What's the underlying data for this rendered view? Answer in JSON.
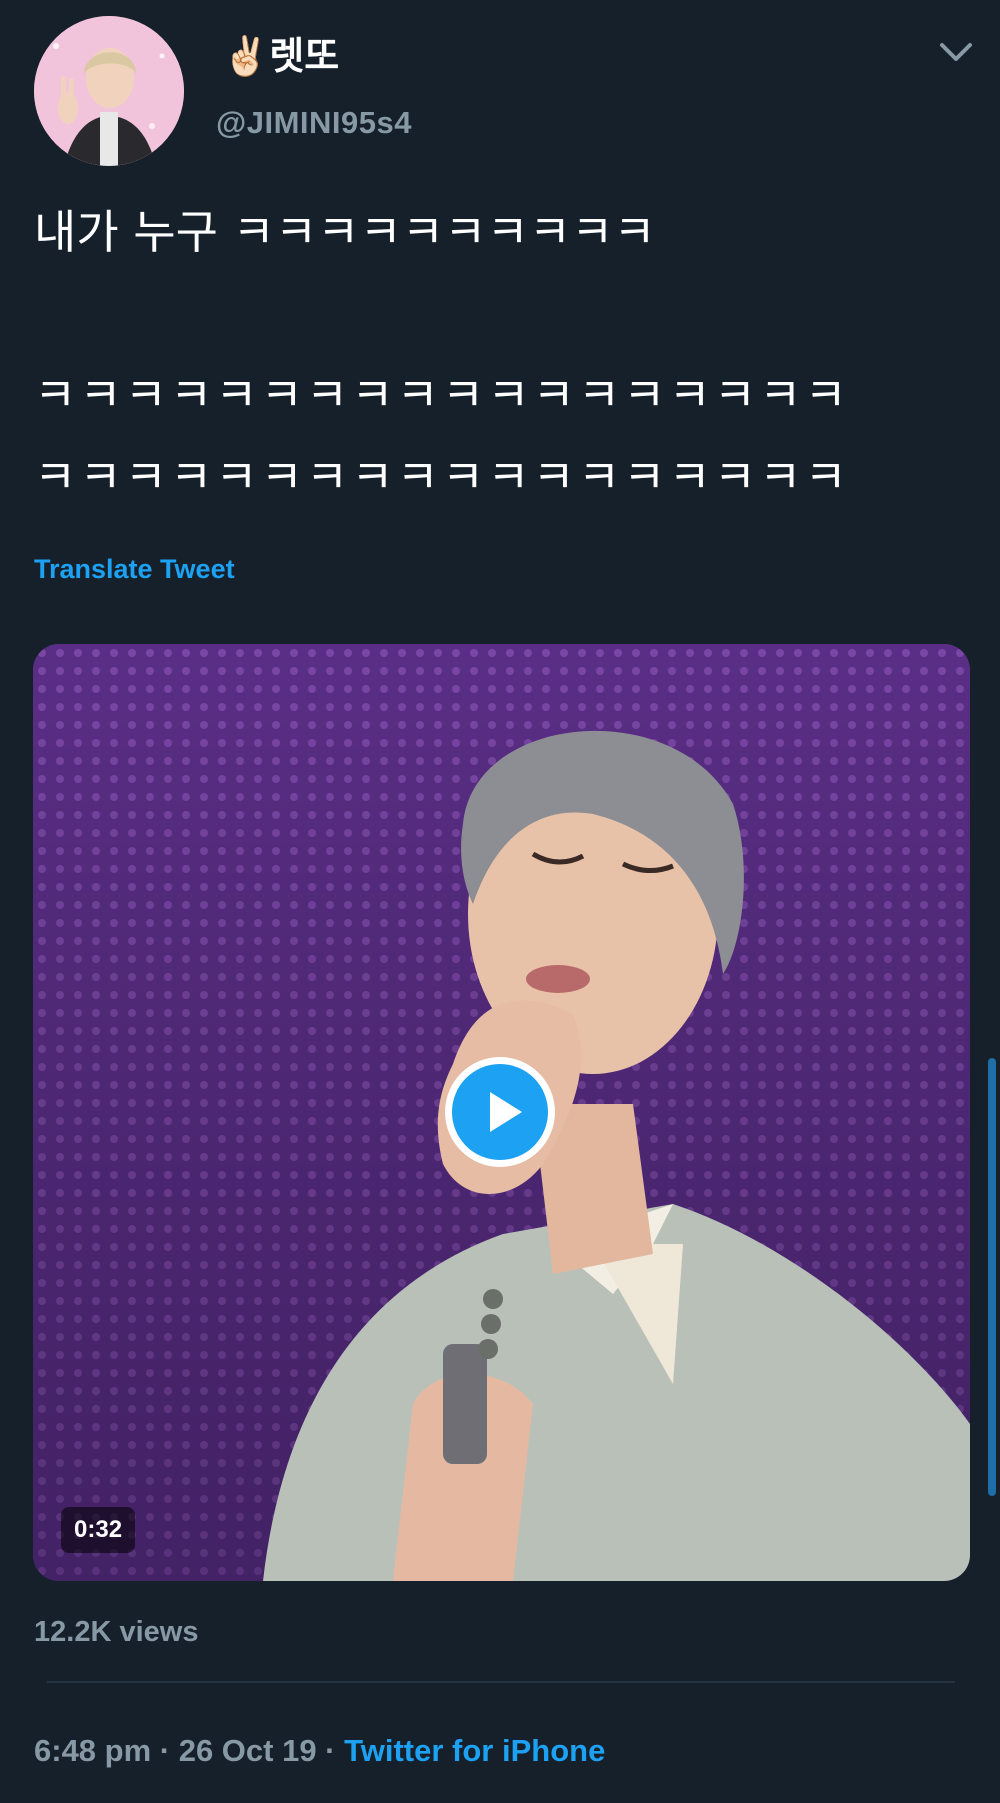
{
  "tweet": {
    "author": {
      "emoji": "✌🏻",
      "display_name": "렛또",
      "handle": "@JIMINI95s4"
    },
    "text_lines": [
      "내가 누구 ㅋㅋㅋㅋㅋㅋㅋㅋㅋㅋ",
      "ㅋㅋㅋㅋㅋㅋㅋㅋㅋㅋㅋㅋㅋㅋㅋㅋㅋㅋ",
      "ㅋㅋㅋㅋㅋㅋㅋㅋㅋㅋㅋㅋㅋㅋㅋㅋㅋㅋ"
    ],
    "translate_label": "Translate Tweet",
    "media": {
      "type": "video",
      "duration": "0:32",
      "play_icon": "play-icon"
    },
    "views": "12.2K views",
    "timestamp": "6:48 pm · 26 Oct 19 · ",
    "client": "Twitter for iPhone"
  },
  "icons": {
    "menu": "chevron-down-icon",
    "avatar": "avatar"
  },
  "colors": {
    "background": "#15202b",
    "accent": "#1da1f2",
    "secondary_text": "#8899a6",
    "divider": "#253341"
  }
}
